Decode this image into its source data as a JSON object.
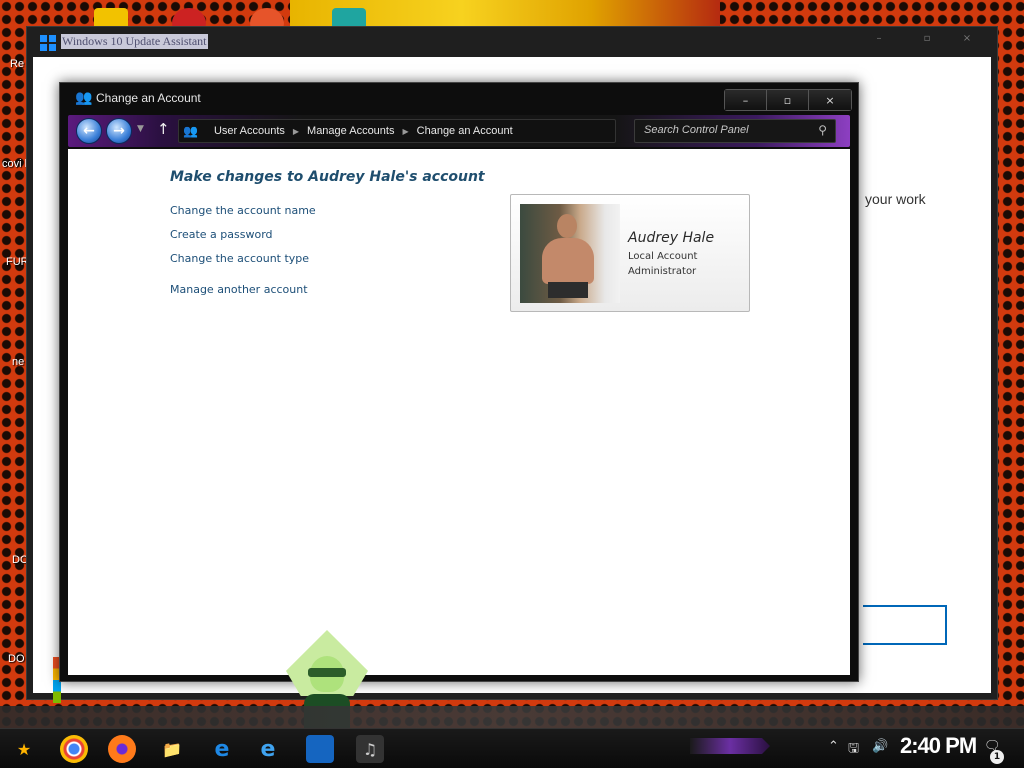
{
  "background_window": {
    "title": "Windows 10 Update Assistant",
    "partial_text": "your work"
  },
  "window": {
    "title": "Change an Account",
    "icon": "users-icon",
    "controls": {
      "minimize": "–",
      "maximize": "▫",
      "close": "×"
    }
  },
  "navigation": {
    "back": "←",
    "forward": "→",
    "breadcrumb": [
      "User Accounts",
      "Manage Accounts",
      "Change an Account"
    ],
    "search_placeholder": "Search Control Panel"
  },
  "content": {
    "heading": "Make changes to Audrey Hale's account",
    "tasks": [
      "Change the account name",
      "Create a password",
      "Change the account type",
      "Manage another account"
    ]
  },
  "user": {
    "name": "Audrey Hale",
    "account_type": "Local Account",
    "role": "Administrator"
  },
  "desktop": {
    "labels": [
      "Re",
      "covi boos",
      "FUR",
      "ne wh",
      "DO",
      "DO"
    ]
  },
  "taskbar": {
    "clock": "2:40 PM",
    "notification_count": "1",
    "apps": [
      "start-icon",
      "chrome-icon",
      "firefox-icon",
      "file-explorer-icon",
      "edge-icon",
      "internet-explorer-icon",
      "windows-icon",
      "media-app-icon"
    ]
  },
  "colors": {
    "link": "#1d4f78",
    "heading": "#1f4e6e",
    "accent_purple": "#6b2fa3"
  }
}
